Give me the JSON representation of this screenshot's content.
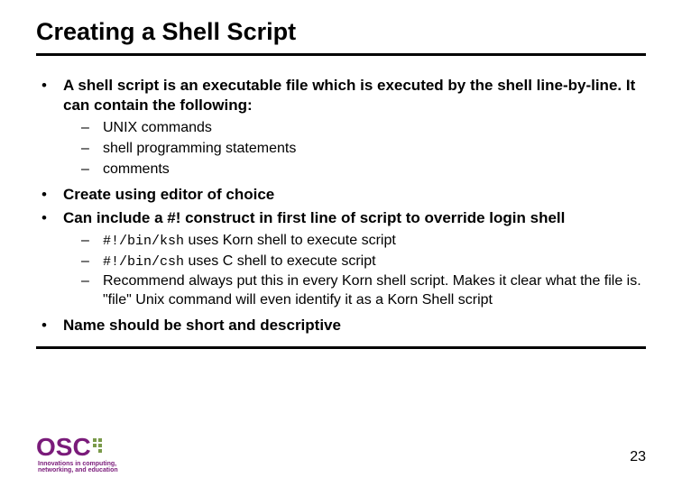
{
  "title": "Creating a Shell Script",
  "bullets": {
    "b1": "A shell script is an executable file which is executed by the shell line-by-line. It can contain the following:",
    "b1_sub": {
      "s1": "UNIX commands",
      "s2": "shell programming statements",
      "s3": "comments"
    },
    "b2": "Create using editor of choice",
    "b3": "Can include a #! construct in first line of script to override login shell",
    "b3_sub": {
      "s1_code": "#!/bin/ksh",
      "s1_rest": " uses Korn shell to execute script",
      "s2_code": "#!/bin/csh",
      "s2_rest": " uses C shell to execute script",
      "s3": "Recommend always put this in every Korn shell script. Makes it clear what the file is. \"file\" Unix command will even identify it as a Korn Shell script"
    },
    "b4": "Name should be short and descriptive"
  },
  "logo": {
    "text": "OSC",
    "tagline1": "Innovations in computing,",
    "tagline2": "networking, and education"
  },
  "page_number": "23"
}
